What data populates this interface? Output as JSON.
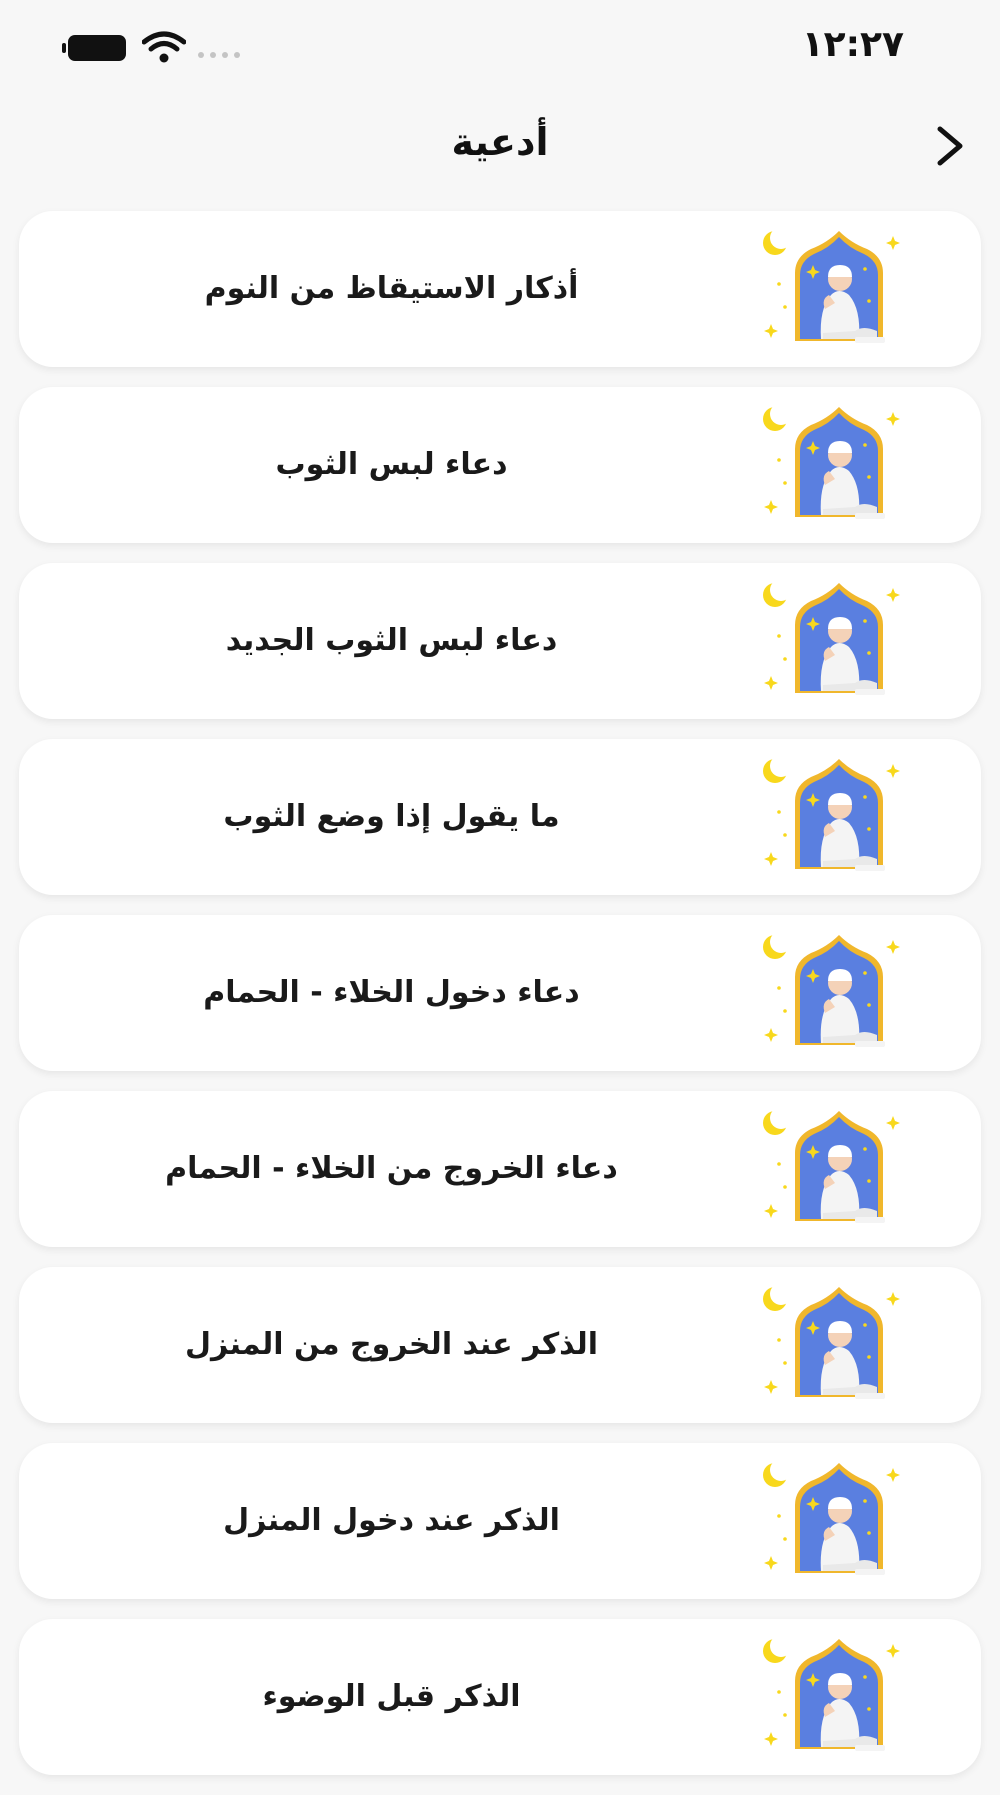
{
  "status_bar": {
    "time": "١٢:٢٧",
    "icons": [
      "battery-icon",
      "wifi-icon",
      "signal-icon"
    ]
  },
  "header": {
    "title": "أدعية",
    "back_icon": "chevron-right-icon"
  },
  "duas": [
    {
      "title": "أذكار الاستيقاظ من النوم",
      "icon": "praying-man-icon"
    },
    {
      "title": "دعاء لبس الثوب",
      "icon": "praying-man-icon"
    },
    {
      "title": "دعاء لبس الثوب الجديد",
      "icon": "praying-man-icon"
    },
    {
      "title": "ما يقول إذا وضع الثوب",
      "icon": "praying-man-icon"
    },
    {
      "title": "دعاء دخول الخلاء - الحمام",
      "icon": "praying-man-icon"
    },
    {
      "title": "دعاء الخروج من الخلاء - الحمام",
      "icon": "praying-man-icon"
    },
    {
      "title": "الذكر عند الخروج من المنزل",
      "icon": "praying-man-icon"
    },
    {
      "title": "الذكر عند دخول المنزل",
      "icon": "praying-man-icon"
    },
    {
      "title": "الذكر قبل الوضوء",
      "icon": "praying-man-icon"
    }
  ],
  "colors": {
    "background": "#f7f7f7",
    "card": "#ffffff",
    "arch_blue": "#5a7fe0",
    "arch_gold": "#f0b72c",
    "moon_yellow": "#f8d81c",
    "text": "#1a1a1a"
  }
}
